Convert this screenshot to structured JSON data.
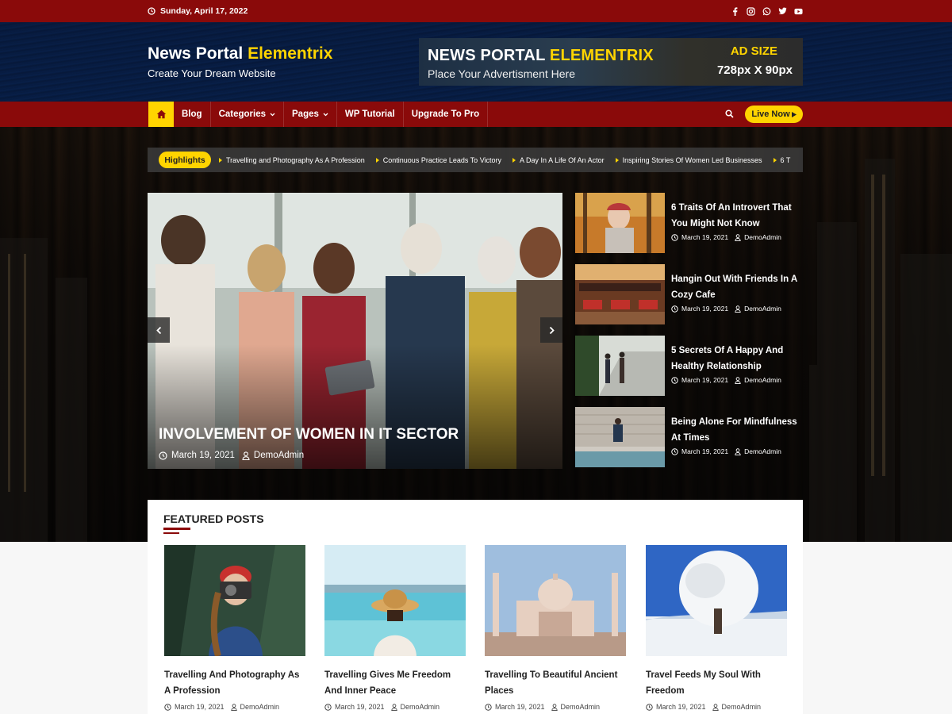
{
  "topbar": {
    "date": "Sunday, April 17, 2022",
    "social": [
      "facebook-icon",
      "instagram-icon",
      "whatsapp-icon",
      "twitter-icon",
      "youtube-icon"
    ]
  },
  "brand": {
    "name_main": "News Portal",
    "name_accent": "Elementrix",
    "tagline": "Create Your Dream Website"
  },
  "ad": {
    "title_main": "NEWS PORTAL",
    "title_accent": "ELEMENTRIX",
    "subtitle": "Place Your Advertisment Here",
    "size_label": "AD SIZE",
    "size_value": "728px X 90px"
  },
  "nav": {
    "items": [
      {
        "label": "Blog"
      },
      {
        "label": "Categories"
      },
      {
        "label": "Pages"
      },
      {
        "label": "WP Tutorial"
      },
      {
        "label": "Upgrade To Pro"
      }
    ],
    "live_label": "Live Now"
  },
  "highlights": {
    "label": "Highlights",
    "items": [
      "Travelling and Photography As A Profession",
      "Continuous Practice Leads To Victory",
      "A Day In A Life Of An Actor",
      "Inspiring Stories Of Women Led Businesses",
      "6 T"
    ]
  },
  "slider": {
    "title": "Involvement Of Women In IT Sector",
    "date": "March 19, 2021",
    "author": "DemoAdmin"
  },
  "side_posts": [
    {
      "title": "6 Traits Of An Introvert That You Might Not Know",
      "date": "March 19, 2021",
      "author": "DemoAdmin"
    },
    {
      "title": "Hangin Out With Friends In A Cozy Cafe",
      "date": "March 19, 2021",
      "author": "DemoAdmin"
    },
    {
      "title": "5 Secrets Of A Happy And Healthy Relationship",
      "date": "March 19, 2021",
      "author": "DemoAdmin"
    },
    {
      "title": "Being Alone For Mindfulness At Times",
      "date": "March 19, 2021",
      "author": "DemoAdmin"
    }
  ],
  "featured": {
    "heading": "FEATURED POSTS",
    "posts": [
      {
        "title": "Travelling And Photography As A Profession",
        "date": "March 19, 2021",
        "author": "DemoAdmin"
      },
      {
        "title": "Travelling Gives Me Freedom And Inner Peace",
        "date": "March 19, 2021",
        "author": "DemoAdmin"
      },
      {
        "title": "Travelling To Beautiful Ancient Places",
        "date": "March 19, 2021",
        "author": "DemoAdmin"
      },
      {
        "title": "Travel Feeds My Soul With Freedom",
        "date": "March 19, 2021",
        "author": "DemoAdmin"
      }
    ]
  },
  "colors": {
    "brand_red": "#8a0a0a",
    "accent_yellow": "#ffd400"
  }
}
